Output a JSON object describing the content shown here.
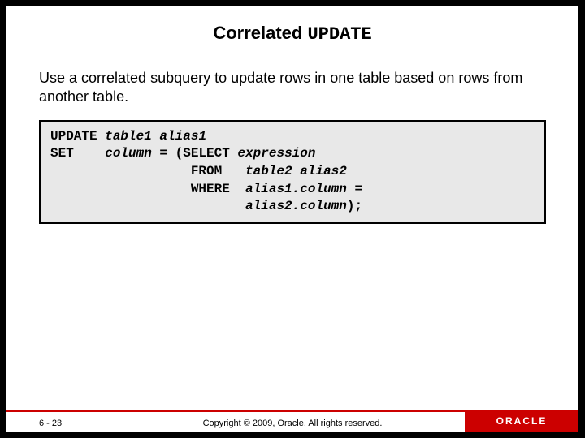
{
  "title": {
    "main": "Correlated ",
    "code": "UPDATE"
  },
  "description": "Use a correlated subquery to update rows in one table based on rows from another table.",
  "code": {
    "l1_kw": "UPDATE ",
    "l1_it": "table1 alias1",
    "l2_kw": "SET    ",
    "l2_it1": "column",
    "l2_mid": " = (SELECT ",
    "l2_it2": "expression",
    "l3_pad": "                  ",
    "l3_kw": "FROM   ",
    "l3_it": "table2 alias2",
    "l4_pad": "                  ",
    "l4_kw": "WHERE  ",
    "l4_it": "alias1.column",
    "l4_eq": " =",
    "l5_pad": "                         ",
    "l5_it": "alias2.column",
    "l5_end": ");"
  },
  "footer": {
    "page": "6 - 23",
    "copyright": "Copyright © 2009, Oracle. All rights reserved.",
    "logo": "ORACLE"
  }
}
